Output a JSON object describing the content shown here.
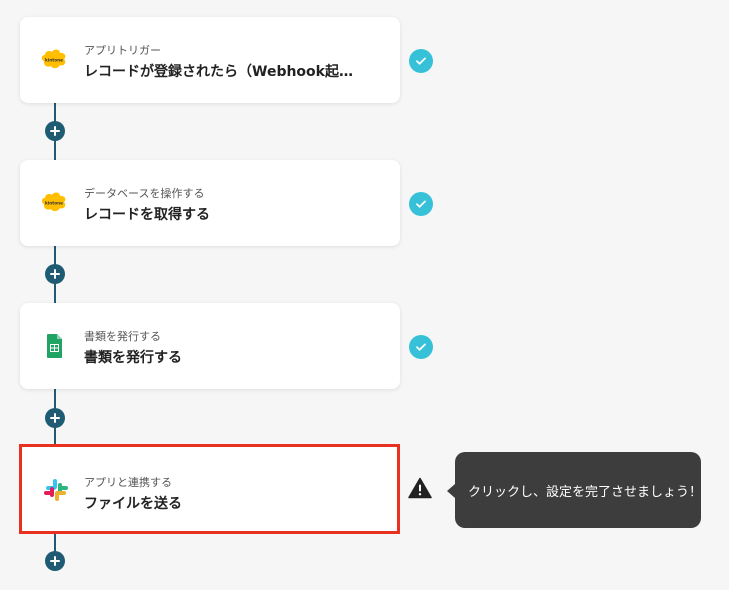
{
  "colors": {
    "connector": "#1f5c73",
    "check": "#36c1d8",
    "selected_border": "#e8321f",
    "tooltip_bg": "#3d3d3d"
  },
  "steps": [
    {
      "sub_label": "アプリトリガー",
      "title": "レコードが登録されたら（Webhook起…",
      "app_icon": "kintone-icon",
      "status": "complete"
    },
    {
      "sub_label": "データベースを操作する",
      "title": "レコードを取得する",
      "app_icon": "kintone-icon",
      "status": "complete"
    },
    {
      "sub_label": "書類を発行する",
      "title": "書類を発行する",
      "app_icon": "google-sheets-icon",
      "status": "complete"
    },
    {
      "sub_label": "アプリと連携する",
      "title": "ファイルを送る",
      "app_icon": "slack-icon",
      "status": "warning"
    }
  ],
  "tooltip": {
    "text": "クリックし、設定を完了させましょう！"
  },
  "kintone_logo_text": "kintone"
}
